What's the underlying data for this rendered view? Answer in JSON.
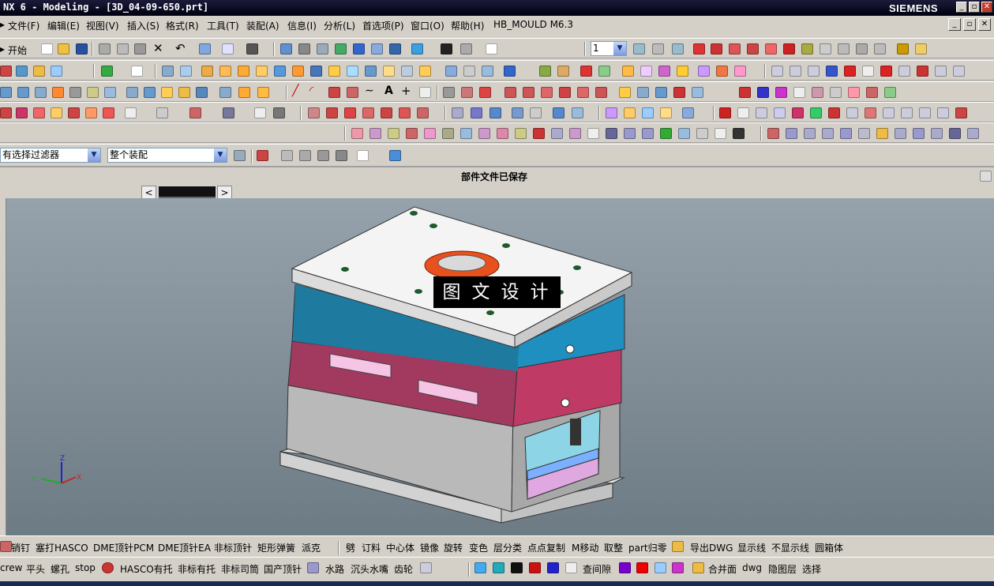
{
  "window": {
    "title": "NX 6 - Modeling - [3D_04-09-650.prt]",
    "brand": "SIEMENS",
    "controls": [
      "_",
      "▫",
      "✕"
    ]
  },
  "menubar": {
    "items": [
      "文件(F)",
      "编辑(E)",
      "视图(V)",
      "插入(S)",
      "格式(R)",
      "工具(T)",
      "装配(A)",
      "信息(I)",
      "分析(L)",
      "首选项(P)",
      "窗口(O)",
      "帮助(H)",
      "HB_MOULD M6.3"
    ]
  },
  "toolbar1": {
    "start_label": "开始",
    "layer_value": "1"
  },
  "selection_bar": {
    "filter_value": "有选择过滤器",
    "scope_value": "整个装配"
  },
  "status": {
    "message": "部件文件已保存"
  },
  "viewport": {
    "watermark": "图文设计",
    "axis_x": "X",
    "axis_y": "Y",
    "axis_z": "Z",
    "colors": {
      "top_plate": "#f4f4f4",
      "cavity_plate": "#1e8fbf",
      "core_plate": "#c03a66",
      "base_block": "#b9b9b9",
      "ring": "#e8501e"
    }
  },
  "bottom_toolbar1": {
    "items": [
      "销钉",
      "塞打HASCO",
      "DME顶针PCM",
      "DME顶针EA",
      "非标顶针",
      "矩形弹簧",
      "派克"
    ],
    "items2": [
      "劈",
      "订料",
      "中心体",
      "镜像",
      "旋转",
      "变色",
      "层分类",
      "点点复制",
      "M移动",
      "取整",
      "part归零",
      "导出DWG",
      "显示线",
      "不显示线",
      "圆箱体"
    ]
  },
  "bottom_toolbar2": {
    "items": [
      "crew",
      "平头",
      "螺孔",
      "stop",
      "HASCO有托",
      "非标有托",
      "非标司筒",
      "国产顶针",
      "水路",
      "沉头水嘴",
      "齿轮"
    ],
    "items2": [
      "查间隙",
      "合并面",
      "dwg",
      "隐图层",
      "选择"
    ]
  }
}
